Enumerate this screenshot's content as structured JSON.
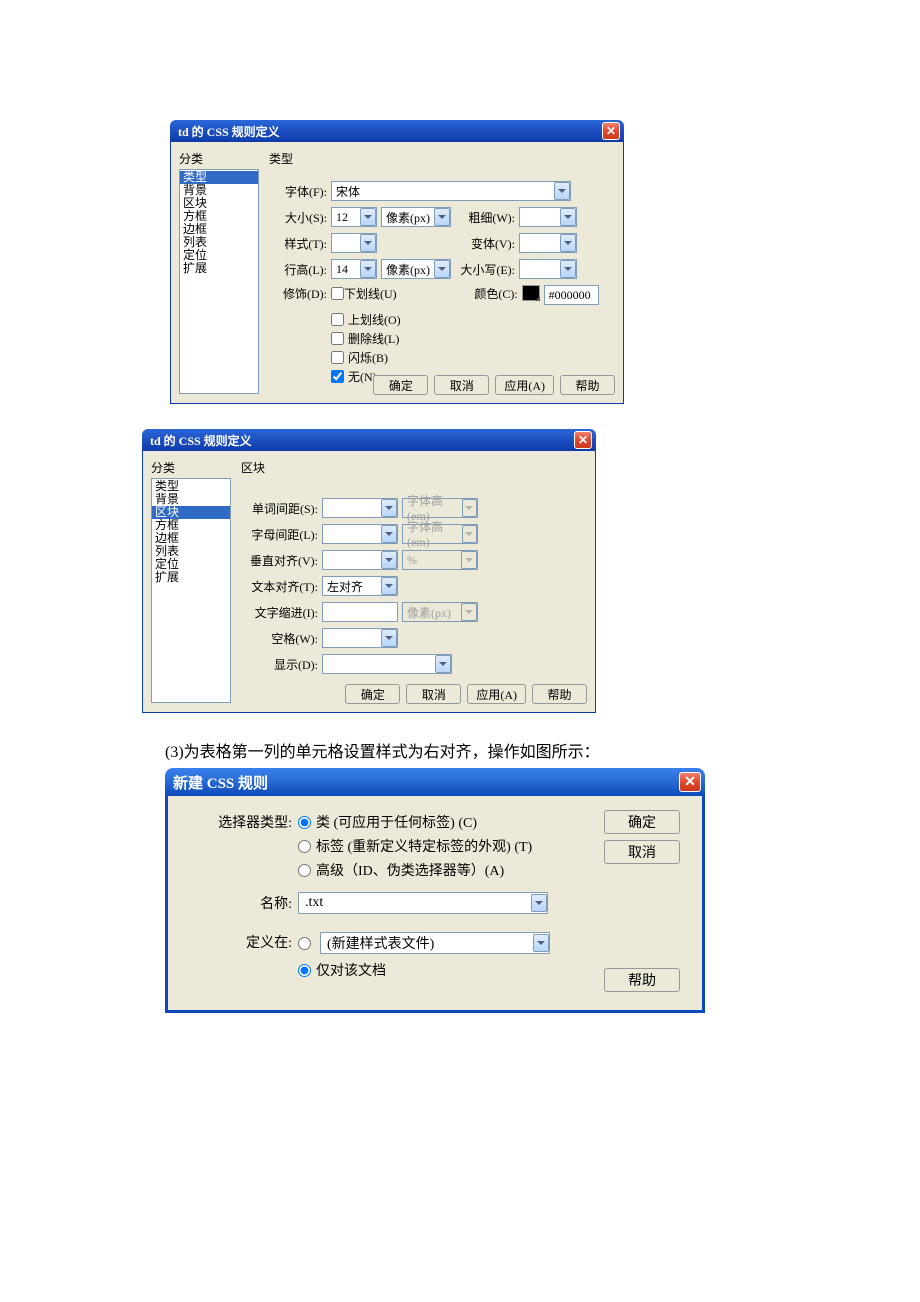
{
  "dialog1": {
    "title": "td 的 CSS 规则定义",
    "categoryLabel": "分类",
    "categories": [
      "类型",
      "背景",
      "区块",
      "方框",
      "边框",
      "列表",
      "定位",
      "扩展"
    ],
    "selectedCategory": 0,
    "section": "类型",
    "labels": {
      "font": "字体(F):",
      "size": "大小(S):",
      "weight": "粗细(W):",
      "style": "样式(T):",
      "variant": "变体(V):",
      "lineHeight": "行高(L):",
      "case": "大小写(E):",
      "decoration": "修饰(D):",
      "color": "颜色(C):"
    },
    "values": {
      "font": "宋体",
      "size": "12",
      "sizeUnit": "像素(px)",
      "lineHeight": "14",
      "lineHeightUnit": "像素(px)",
      "color": "#000000"
    },
    "decoration": {
      "underline": "下划线(U)",
      "overline": "上划线(O)",
      "strike": "删除线(L)",
      "blink": "闪烁(B)",
      "none": "无(N)"
    },
    "buttons": {
      "ok": "确定",
      "cancel": "取消",
      "apply": "应用(A)",
      "help": "帮助"
    }
  },
  "dialog2": {
    "title": "td 的 CSS 规则定义",
    "categoryLabel": "分类",
    "categories": [
      "类型",
      "背景",
      "区块",
      "方框",
      "边框",
      "列表",
      "定位",
      "扩展"
    ],
    "selectedCategory": 2,
    "section": "区块",
    "labels": {
      "wordSpacing": "单词间距(S):",
      "letterSpacing": "字母间距(L):",
      "vAlign": "垂直对齐(V):",
      "textAlign": "文本对齐(T):",
      "indent": "文字缩进(I):",
      "whitespace": "空格(W):",
      "display": "显示(D):"
    },
    "units": {
      "em1": "字体高(em)",
      "em2": "字体高(em)",
      "pct": "%",
      "px": "像素(px)"
    },
    "values": {
      "textAlign": "左对齐"
    },
    "buttons": {
      "ok": "确定",
      "cancel": "取消",
      "apply": "应用(A)",
      "help": "帮助"
    }
  },
  "caption3": "(3)为表格第一列的单元格设置样式为右对齐，操作如图所示：",
  "dialog3": {
    "title": "新建 CSS 规则",
    "labels": {
      "selectorType": "选择器类型:",
      "name": "名称:",
      "defineIn": "定义在:"
    },
    "selectorOptions": {
      "class": "类 (可应用于任何标签) (C)",
      "tag": "标签 (重新定义特定标签的外观) (T)",
      "adv": "高级（ID、伪类选择器等）(A)"
    },
    "nameValue": ".txt",
    "defineOptions": {
      "newFile": "(新建样式表文件)",
      "docOnly": "仅对该文档"
    },
    "buttons": {
      "ok": "确定",
      "cancel": "取消",
      "help": "帮助"
    }
  }
}
